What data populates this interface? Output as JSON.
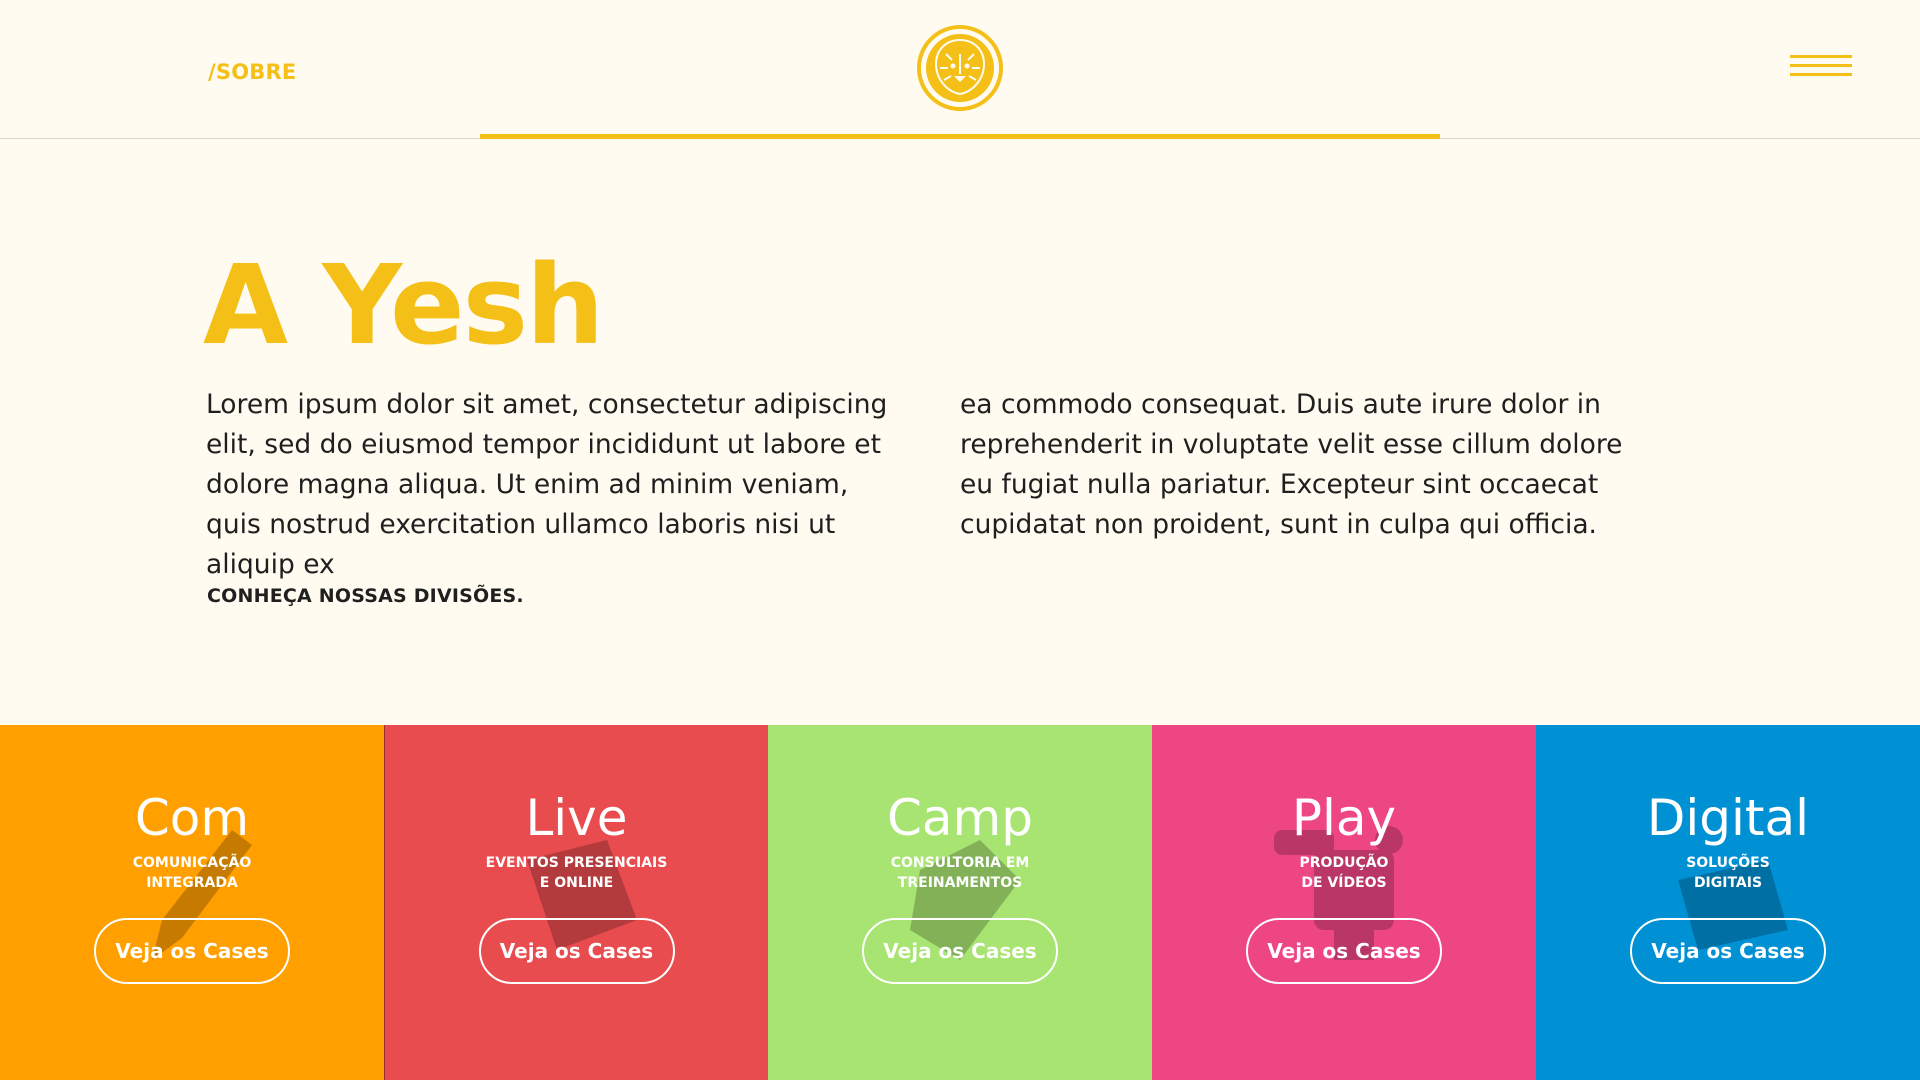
{
  "header": {
    "nav_link": "/SOBRE",
    "logo_icon": "lion-icon",
    "menu_icon": "hamburger-icon",
    "accent_color": "#f4bf17"
  },
  "intro": {
    "title": "A Yesh",
    "paragraph_left": "Lorem ipsum dolor sit amet, consectetur adipiscing elit, sed do eiusmod tempor incididunt ut labore et dolore magna aliqua. Ut enim ad minim veniam, quis nostrud exercitation ullamco laboris nisi ut aliquip ex",
    "paragraph_right": "ea commodo consequat. Duis aute irure dolor in reprehenderit in voluptate velit esse cillum dolore eu fugiat nulla pariatur. Excepteur sint occaecat cupidatat non proident, sunt in culpa qui officia.",
    "divisions_heading": "CONHEÇA NOSSAS DIVISÕES."
  },
  "divisions": [
    {
      "title": "Com",
      "subtitle": "COMUNICAÇÃO\nINTEGRADA",
      "button": "Veja os Cases",
      "color": "#ff9f00",
      "icon": "pencil-icon"
    },
    {
      "title": "Live",
      "subtitle": "EVENTOS PRESENCIAIS\nE ONLINE",
      "button": "Veja os Cases",
      "color": "#e84c4f",
      "icon": "ticket-icon"
    },
    {
      "title": "Camp",
      "subtitle": "CONSULTORIA EM\nTREINAMENTOS",
      "button": "Veja os Cases",
      "color": "#a8e472",
      "icon": "cube-icon"
    },
    {
      "title": "Play",
      "subtitle": "PRODUÇÃO\nDE VÍDEOS",
      "button": "Veja os Cases",
      "color": "#ee4683",
      "icon": "camera-icon"
    },
    {
      "title": "Digital",
      "subtitle": "SOLUÇÕES\nDIGITAIS",
      "button": "Veja os Cases",
      "color": "#0091d4",
      "icon": "tablet-icon"
    }
  ]
}
